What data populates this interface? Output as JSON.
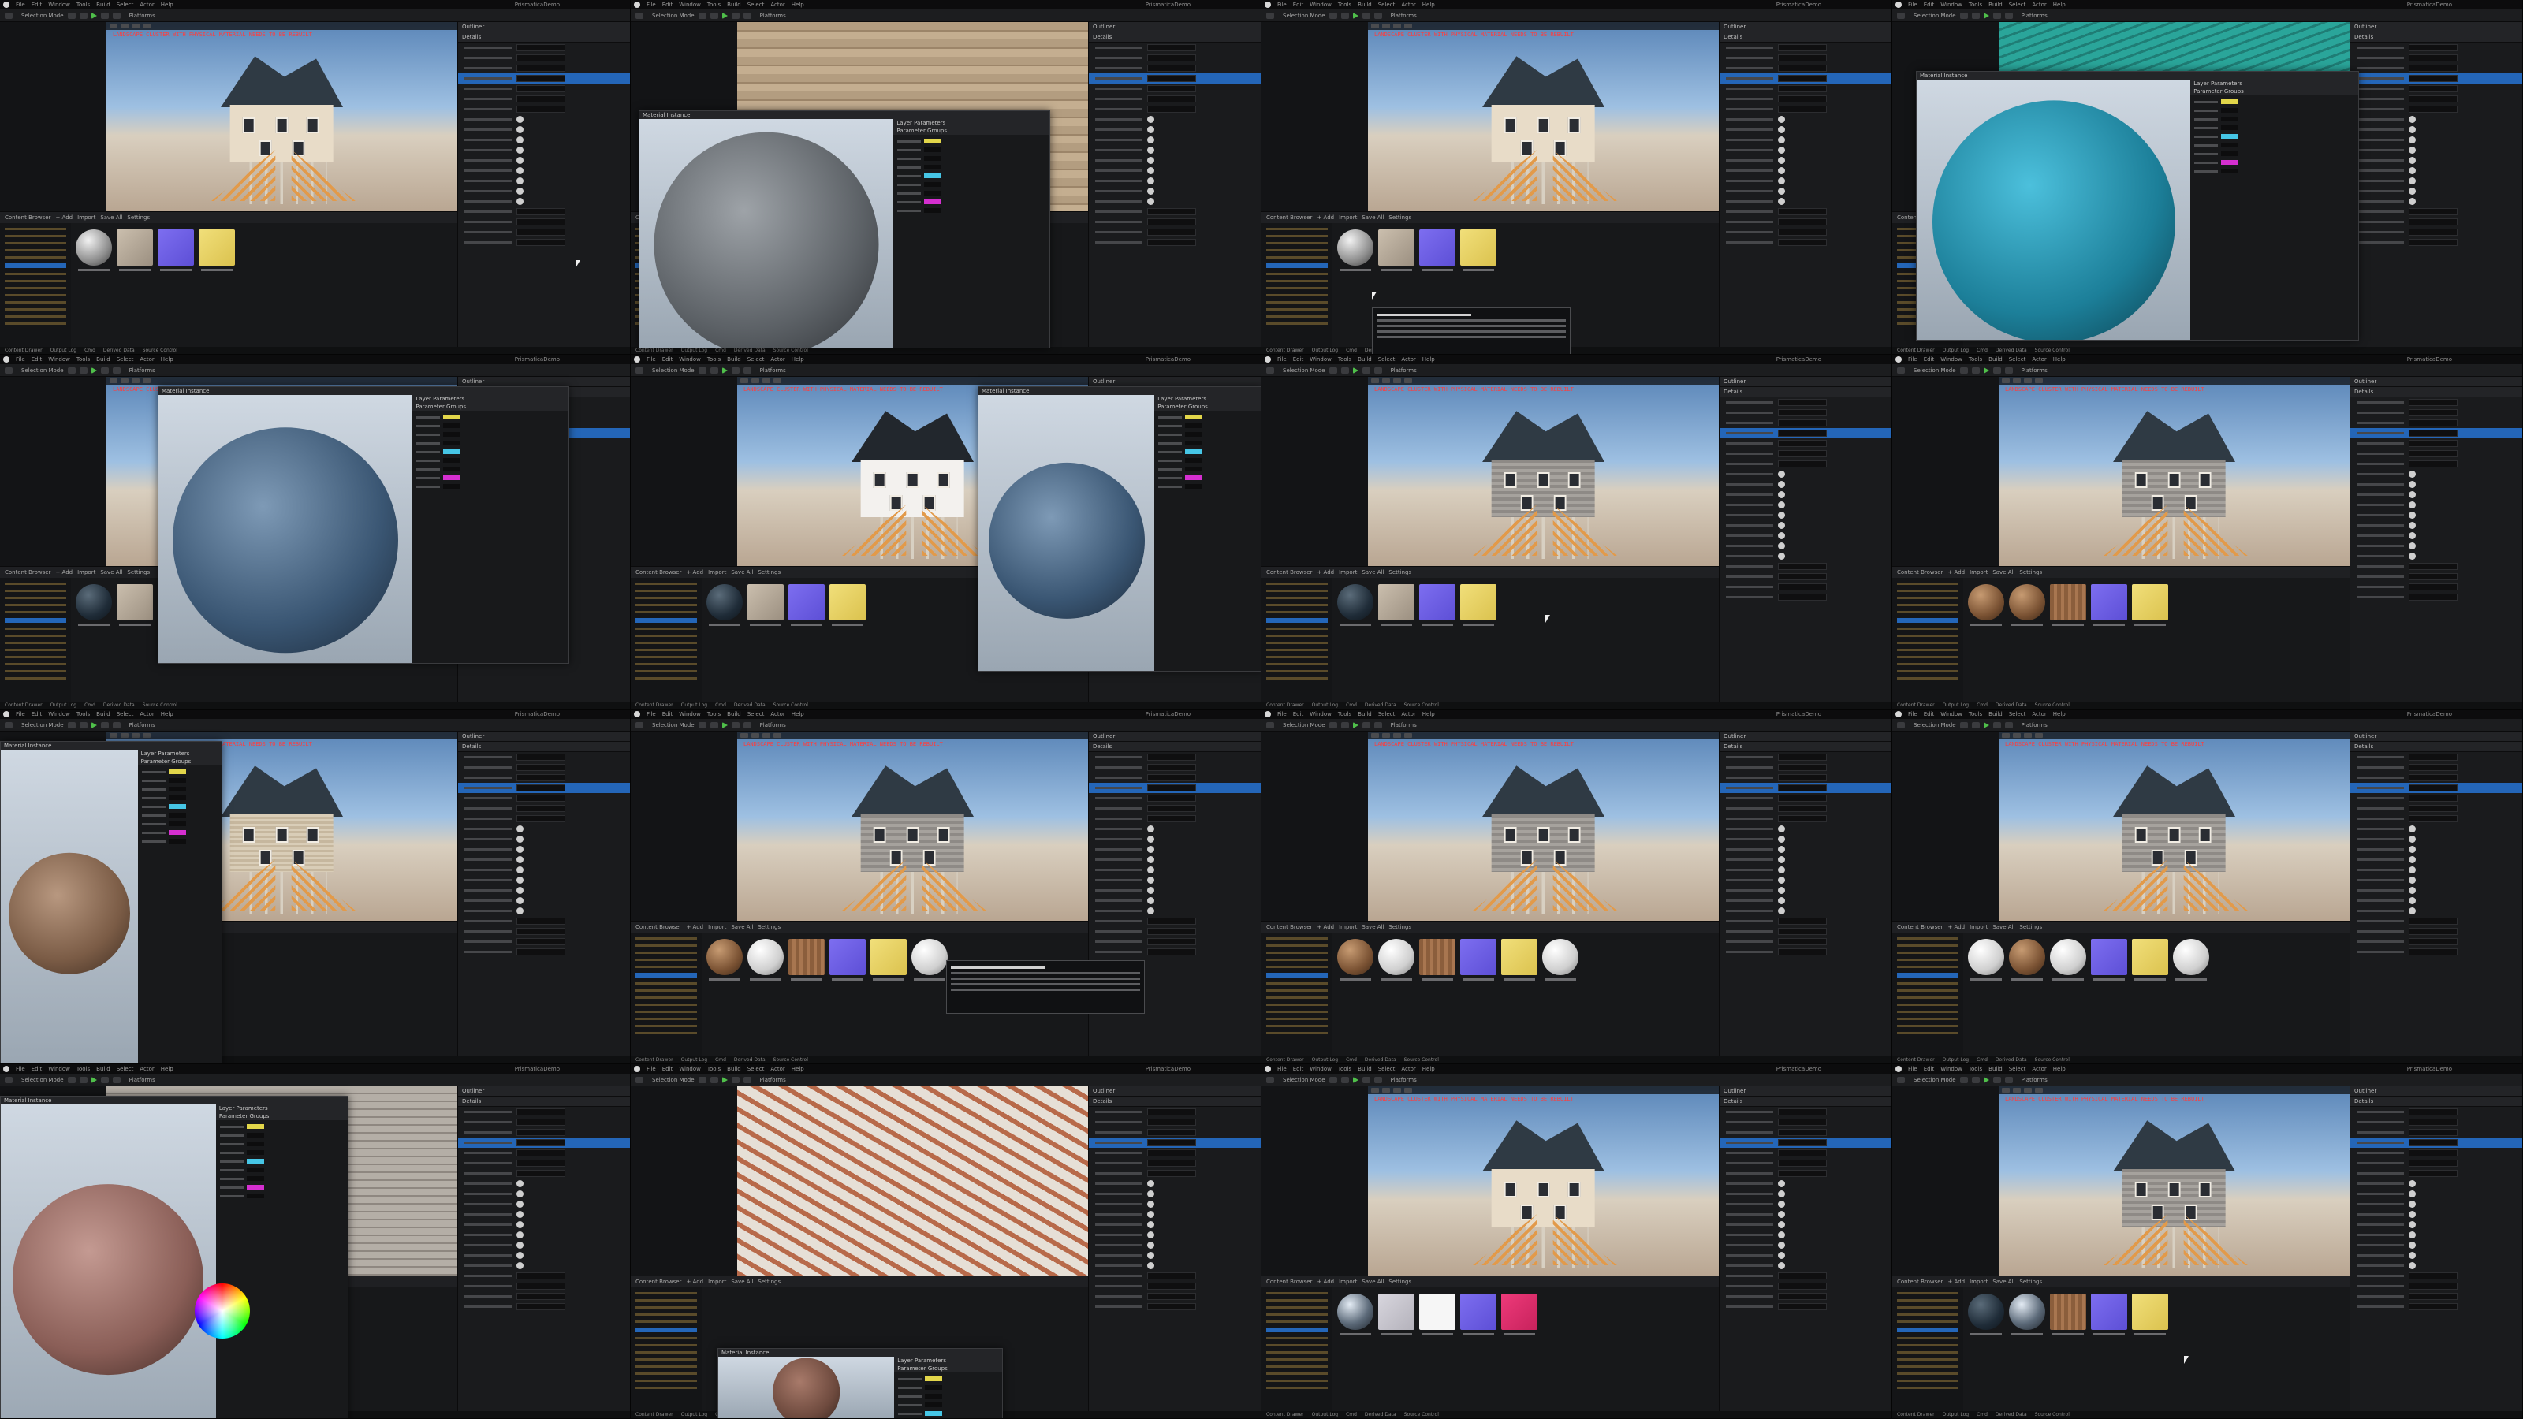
{
  "app": {
    "menu": [
      "File",
      "Edit",
      "Window",
      "Tools",
      "Build",
      "Select",
      "Actor",
      "Help"
    ],
    "project_name": "PrismaticaDemo",
    "toolbar_mode": "Selection Mode",
    "toolbar_platforms": "Platforms",
    "viewport_warning": "LANDSCAPE CLUSTER WITH PHYSICAL MATERIAL NEEDS TO BE REBUILT",
    "details_title": "Details",
    "outliner_title": "Outliner",
    "content_browser_title": "Content Browser",
    "content_browser_add": "+ Add",
    "content_browser_import": "Import",
    "content_browser_save": "Save All",
    "content_browser_settings": "Settings",
    "status": {
      "drawer": "Content Drawer",
      "log": "Output Log",
      "cmd": "Cmd",
      "source": "Source Control",
      "derived": "Derived Data"
    },
    "material_editor_title": "Material Instance",
    "layer_params_tab": "Layer Parameters",
    "parameter_groups_label": "Parameter Groups"
  },
  "colors": {
    "accent": "#2466b8",
    "warning": "#ff3d3d",
    "play": "#4fbf4a",
    "roof": "#2f3a44",
    "yellow_param": "#e2d64a",
    "cyan_param": "#46c6e6",
    "magenta_param": "#d52fd0"
  },
  "tiles": [
    {
      "view": "house",
      "house_style": "cream",
      "thumbs": [
        "sphere-gray",
        "beige",
        "purple",
        "yellow"
      ],
      "cursor": true
    },
    {
      "view": "closeup-stone-window",
      "float": "sphere-stone",
      "thumbs": []
    },
    {
      "view": "house",
      "house_style": "cream",
      "thumbs": [
        "sphere-gray",
        "beige",
        "purple",
        "yellow"
      ],
      "tooltip": true,
      "cursor": true
    },
    {
      "view": "closeup-teal-roof",
      "float": "sphere-teal",
      "thumbs": []
    },
    {
      "view": "house",
      "house_style": "cream",
      "float": "sphere-blue",
      "thumbs": [
        "sphere-dark",
        "beige",
        "purple",
        "yellow"
      ]
    },
    {
      "view": "house",
      "house_style": "white",
      "float": "sphere-blue",
      "thumbs": [
        "sphere-dark",
        "beige",
        "purple",
        "yellow"
      ]
    },
    {
      "view": "house",
      "house_style": "stone",
      "thumbs": [
        "sphere-dark",
        "beige",
        "purple",
        "yellow"
      ],
      "cursor": true
    },
    {
      "view": "house",
      "house_style": "stone",
      "thumbs": [
        "sphere-wood",
        "sphere-wood",
        "wood",
        "purple",
        "yellow"
      ]
    },
    {
      "view": "house",
      "house_style": "wood",
      "float": "sphere-wood-side",
      "thumbs": [
        "purple",
        "yellow"
      ]
    },
    {
      "view": "house",
      "house_style": "stone",
      "thumbs": [
        "sphere-wood",
        "sphere-white",
        "wood",
        "purple",
        "yellow",
        "sphere-white"
      ],
      "tooltip": true
    },
    {
      "view": "house",
      "house_style": "stone",
      "thumbs": [
        "sphere-wood",
        "sphere-white",
        "wood",
        "purple",
        "yellow",
        "sphere-white"
      ]
    },
    {
      "view": "house",
      "house_style": "stone",
      "thumbs": [
        "sphere-white",
        "sphere-wood",
        "sphere-white",
        "purple",
        "yellow",
        "sphere-white"
      ]
    },
    {
      "view": "closeup-wood-door",
      "float": "sphere-pink-colorpicker",
      "thumbs": [
        "sphere-white"
      ]
    },
    {
      "view": "closeup-stairs",
      "float": "sphere-wood-bottom",
      "thumbs": []
    },
    {
      "view": "house",
      "house_style": "cream",
      "thumbs": [
        "sphere-chrome",
        "light-gray",
        "white",
        "purple",
        "pink"
      ]
    },
    {
      "view": "house",
      "house_style": "stone",
      "thumbs": [
        "sphere-dark",
        "sphere-chrome",
        "wood",
        "purple",
        "yellow"
      ],
      "cursor": true
    }
  ]
}
